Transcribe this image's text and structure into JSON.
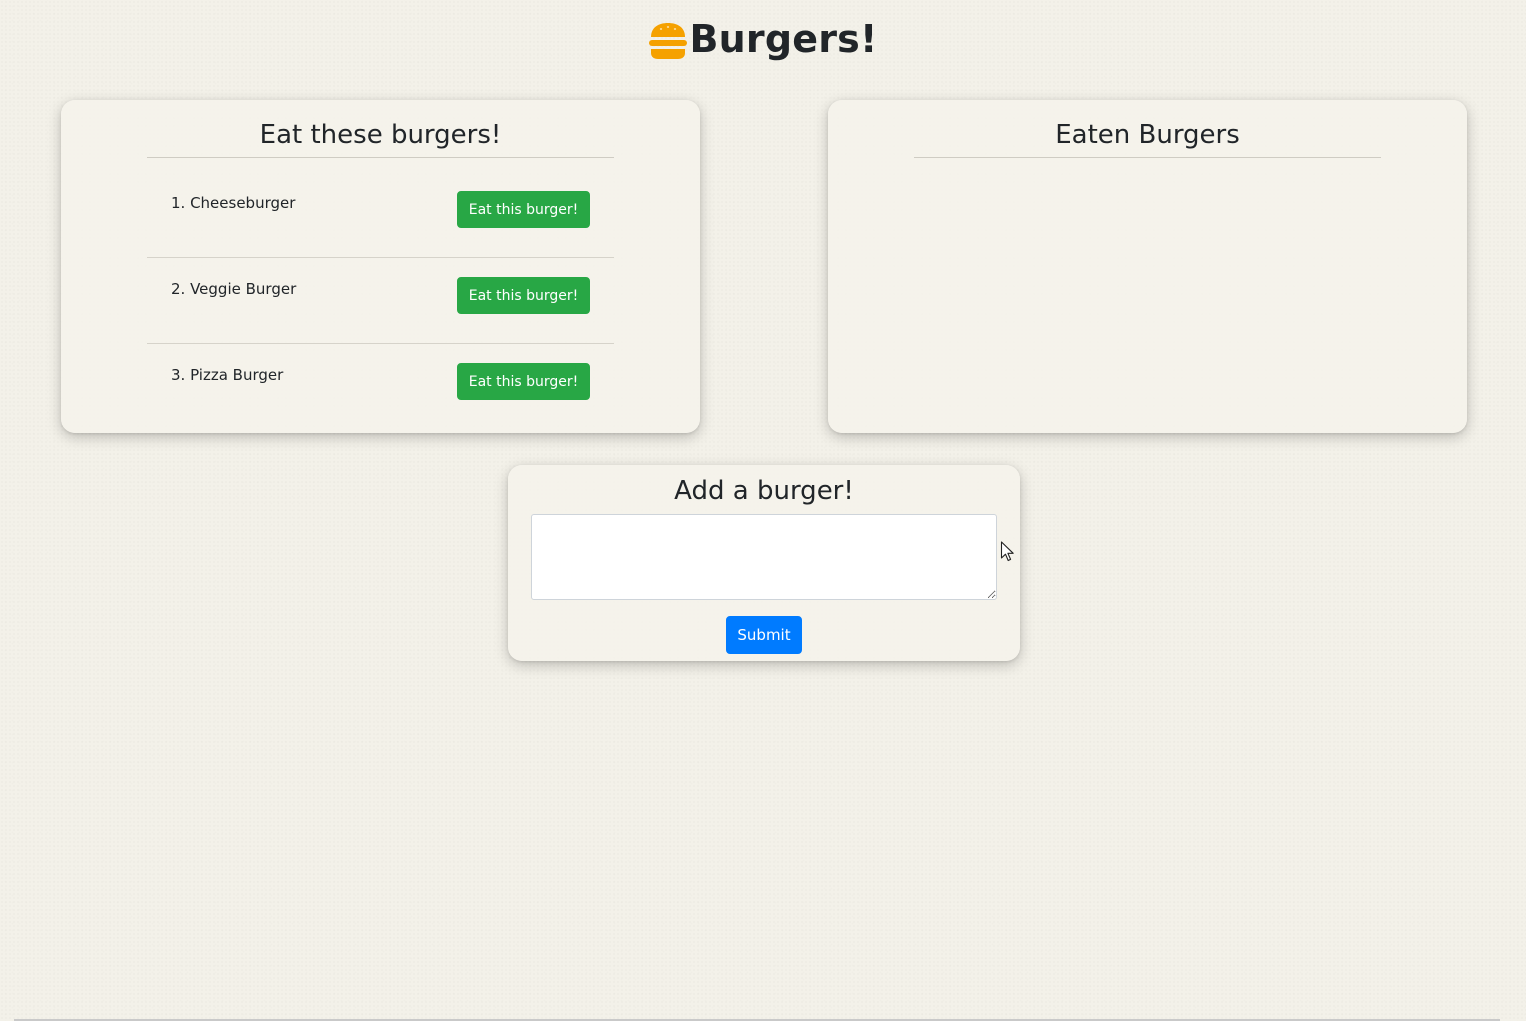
{
  "header": {
    "title": "Burgers!",
    "logo_icon": "burger-icon"
  },
  "uneaten": {
    "heading": "Eat these burgers!",
    "items": [
      {
        "name": "1. Cheeseburger",
        "button_label": "Eat this burger!"
      },
      {
        "name": "2. Veggie Burger",
        "button_label": "Eat this burger!"
      },
      {
        "name": "3. Pizza Burger",
        "button_label": "Eat this burger!"
      }
    ]
  },
  "eaten": {
    "heading": "Eaten Burgers",
    "items": []
  },
  "add_form": {
    "heading": "Add a burger!",
    "input_value": "",
    "submit_label": "Submit"
  },
  "colors": {
    "background": "#f3f1e9",
    "eat_button": "#28a745",
    "submit_button": "#007bff",
    "logo": "#f5a100"
  }
}
